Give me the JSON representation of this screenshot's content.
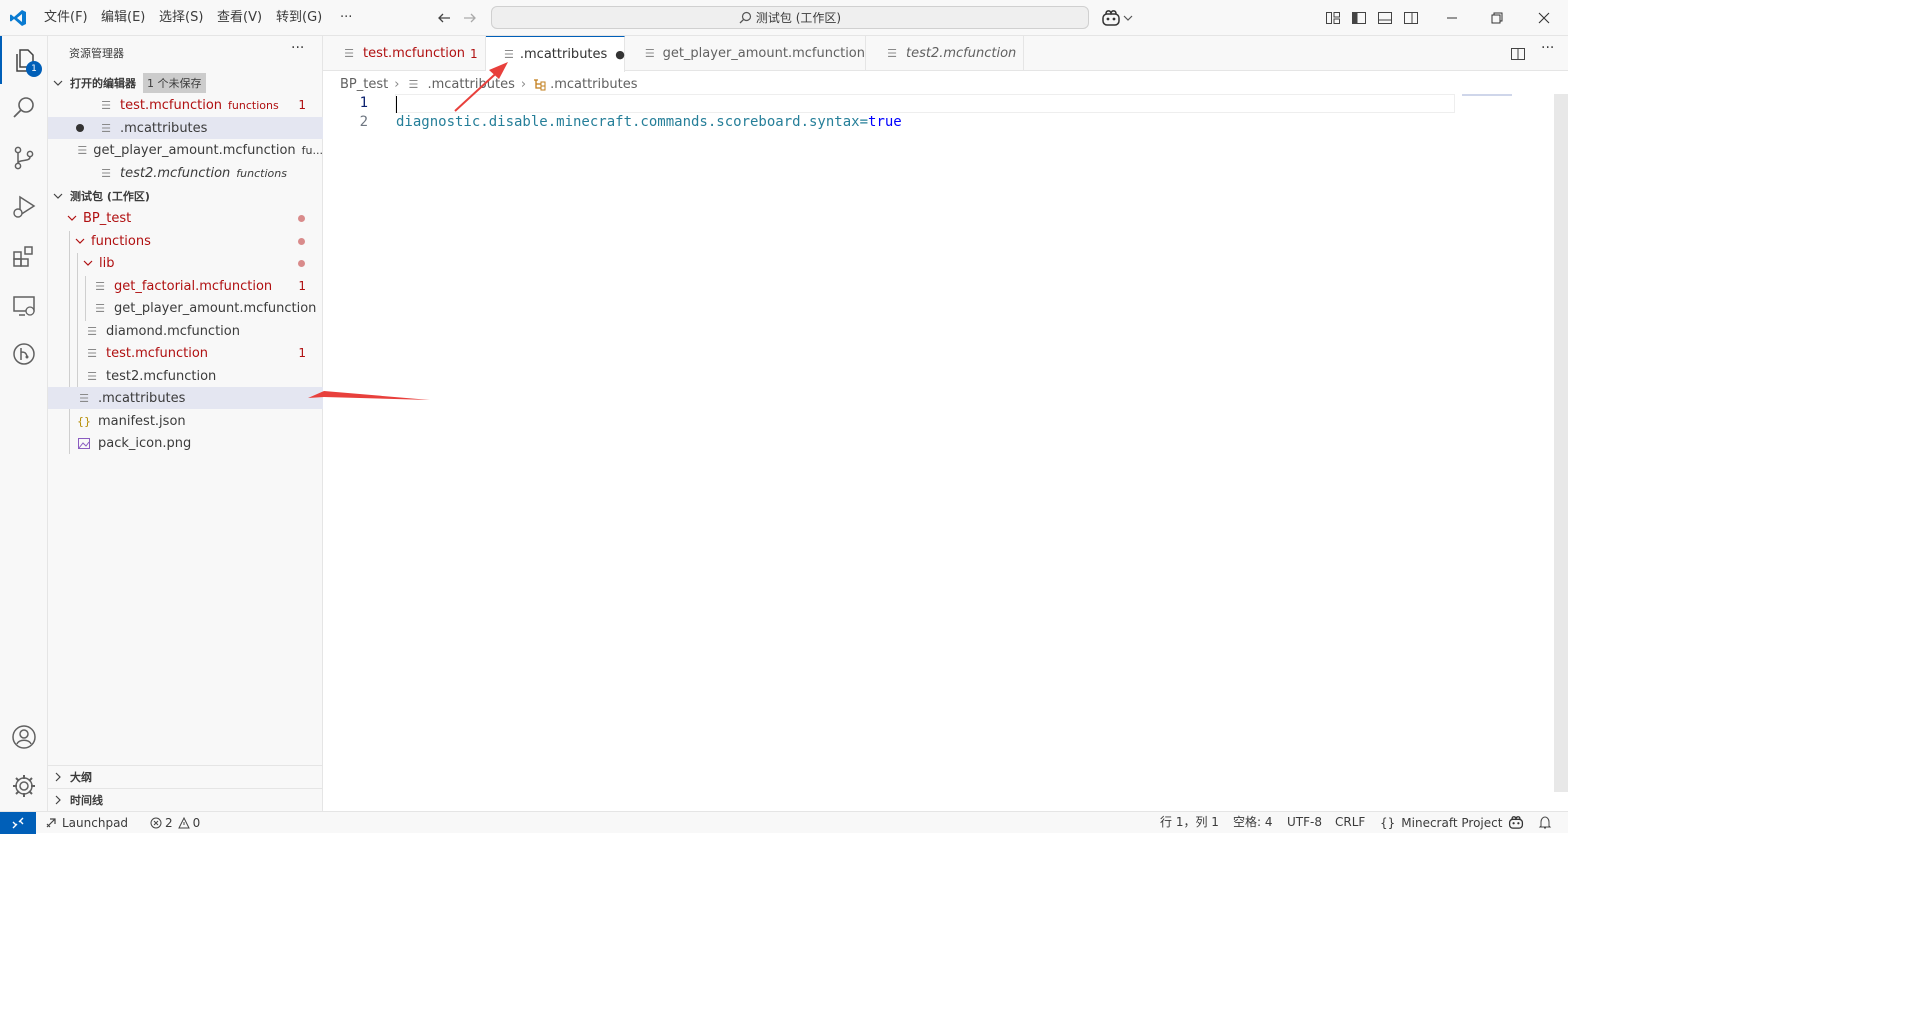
{
  "titlebar": {
    "menus": [
      "文件(F)",
      "编辑(E)",
      "选择(S)",
      "查看(V)",
      "转到(G)"
    ],
    "more": "···",
    "search_text": "测试包 (工作区)"
  },
  "activity": {
    "explorer_badge": "1"
  },
  "sidebar": {
    "title": "资源管理器",
    "more": "···",
    "open_editors": {
      "label": "打开的编辑器",
      "badge": "1 个未保存",
      "items": [
        {
          "name": "test.mcfunction",
          "desc": "functions",
          "count": "1"
        },
        {
          "name": ".mcattributes",
          "desc": ""
        },
        {
          "name": "get_player_amount.mcfunction",
          "desc": "fu..."
        },
        {
          "name": "test2.mcfunction",
          "desc": "functions"
        }
      ]
    },
    "workspace": {
      "label": "测试包 (工作区)",
      "tree": [
        {
          "name": "BP_test"
        },
        {
          "name": "functions"
        },
        {
          "name": "lib"
        },
        {
          "name": "get_factorial.mcfunction",
          "count": "1"
        },
        {
          "name": "get_player_amount.mcfunction"
        },
        {
          "name": "diamond.mcfunction"
        },
        {
          "name": "test.mcfunction",
          "count": "1"
        },
        {
          "name": "test2.mcfunction"
        },
        {
          "name": ".mcattributes"
        },
        {
          "name": "manifest.json"
        },
        {
          "name": "pack_icon.png"
        }
      ]
    },
    "outline": "大纲",
    "timeline": "时间线"
  },
  "tabs": [
    {
      "label": "test.mcfunction",
      "count": "1"
    },
    {
      "label": ".mcattributes",
      "dirty": "●"
    },
    {
      "label": "get_player_amount.mcfunction"
    },
    {
      "label": "test2.mcfunction"
    }
  ],
  "breadcrumb": [
    "BP_test",
    ".mcattributes",
    ".mcattributes"
  ],
  "editor": {
    "line_numbers": [
      "1",
      "2"
    ],
    "line2_key": "diagnostic.disable.minecraft.commands.scoreboard.syntax=",
    "line2_value": "true"
  },
  "statusbar": {
    "launchpad": "Launchpad",
    "errors": "2",
    "warnings": "0",
    "position": "行 1，列 1",
    "spaces": "空格: 4",
    "encoding": "UTF-8",
    "eol": "CRLF",
    "language": "Minecraft Project"
  },
  "colors": {
    "accent": "#005fb8",
    "error": "#b01011",
    "annotation_arrow": "#e8403c"
  }
}
